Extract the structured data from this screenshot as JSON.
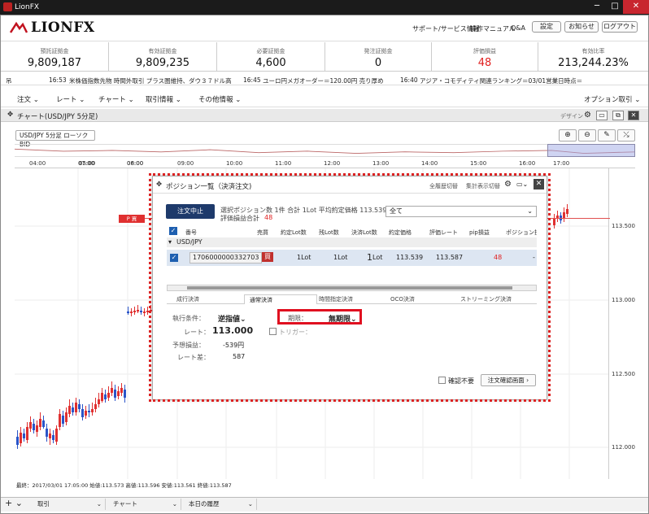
{
  "window": {
    "title": "LionFX",
    "minimize": "─",
    "maximize": "□",
    "close": "✕"
  },
  "header": {
    "logo_text": "LIONFX",
    "links": [
      "サポート/サービス情報",
      "操作マニュアル",
      "Q&A"
    ],
    "buttons": [
      "設定",
      "お知らせ",
      "ログアウト"
    ]
  },
  "summary": [
    {
      "label": "預託証拠金",
      "value": "9,809,187",
      "color": "#111111"
    },
    {
      "label": "有効証拠金",
      "value": "9,809,235",
      "color": "#111111"
    },
    {
      "label": "必要証拠金",
      "value": "4,600",
      "color": "#111111"
    },
    {
      "label": "発注証拠金",
      "value": "0",
      "color": "#111111"
    },
    {
      "label": "評価損益",
      "value": "48",
      "color": "#e02020"
    },
    {
      "label": "有効比率",
      "value": "213,244.23%",
      "color": "#111111"
    }
  ],
  "ticker": [
    {
      "time": "16:53",
      "text": "米株価指数先物 時間外取引 プラス圏維持、ダウ３７ドル高"
    },
    {
      "time": "16:45",
      "text": "ユーロ円メガオーダー＝120.00円 売り厚め"
    },
    {
      "time": "16:40",
      "text": "アジア・コモディティ関連ランキング＝03/01営業日時点＝"
    }
  ],
  "ticker_prefix": "吊",
  "menu": [
    "注文",
    "レート",
    "チャート",
    "取引情報",
    "その他情報"
  ],
  "menu_right": "オプション取引",
  "chart": {
    "panel_title": "チャート(USD/JPY 5分足)",
    "design_label": "デザイン",
    "symbol": "USD/JPY 5分足 ローソク BID",
    "time_labels": [
      "04:00",
      "05:00",
      "06:00",
      "07:00",
      "08:00",
      "09:00",
      "10:00",
      "11:00",
      "12:00",
      "13:00",
      "14:00",
      "15:00",
      "16:00",
      "17:00"
    ],
    "price_labels": [
      "113.500",
      "113.000",
      "112.500",
      "112.000"
    ],
    "position_marker": "買",
    "position_marker_prefix": "P",
    "ohlc": "最終：2017/03/01 17:05:00 始値:113.573 高値:113.596 安値:113.561 終値:113.587"
  },
  "chart_data": {
    "type": "candlestick",
    "title": "USD/JPY 5分足 ローソク BID",
    "x_ticks": [
      "04:00",
      "05:00",
      "06:00",
      "07:00",
      "08:00",
      "09:00",
      "10:00",
      "11:00",
      "12:00",
      "13:00",
      "14:00",
      "15:00",
      "16:00",
      "17:00"
    ],
    "y_ticks": [
      113.5,
      113.0,
      112.5,
      112.0
    ],
    "last_bar": {
      "time": "2017/03/01 17:05:00",
      "open": 113.573,
      "high": 113.596,
      "low": 113.561,
      "close": 113.587
    }
  },
  "dialog": {
    "title": "ポジション一覧（決済注文)",
    "right_links": [
      "全履歴切替",
      "集計表示切替"
    ],
    "cancel_button": "注文中止",
    "summary_line1": "選択ポジション数 1件  合計 1Lot  平均約定価格 113.539",
    "summary_line2_label": "評価損益合計",
    "summary_line2_value": "48",
    "filter": "全て",
    "columns": [
      "番号",
      "売買",
      "約定Lot数",
      "残Lot数",
      "決済Lot数",
      "約定価格",
      "評価レート",
      "pip損益",
      "ポジション損益"
    ],
    "group": "USD/JPY",
    "row": {
      "id": "1706000000332703",
      "side": "買",
      "lot": "1Lot",
      "remain": "1Lot",
      "settle_num": "1",
      "settle_unit": "Lot",
      "price": "113.539",
      "rate": "113.587",
      "pip": "48",
      "pl": "-"
    },
    "tabs": [
      "成行決済",
      "通常決済",
      "時間指定決済",
      "OCO決済",
      "ストリーミング決済"
    ],
    "active_tab": "通常決済",
    "form": {
      "condition_label": "執行条件：",
      "condition_value": "逆指値",
      "rate_label": "レート：",
      "rate_value": "113.000",
      "expect_label": "予想損益：",
      "expect_value": "-539円",
      "diff_label": "レート差：",
      "diff_value": "587",
      "expiry_label": "期限：",
      "expiry_value": "無期限",
      "trigger_label": "トリガー："
    },
    "no_confirm": "確認不要",
    "confirm_button": "注文確認画面"
  },
  "bottom": {
    "tabs": [
      "取引",
      "チャート",
      "本日の履歴"
    ]
  }
}
